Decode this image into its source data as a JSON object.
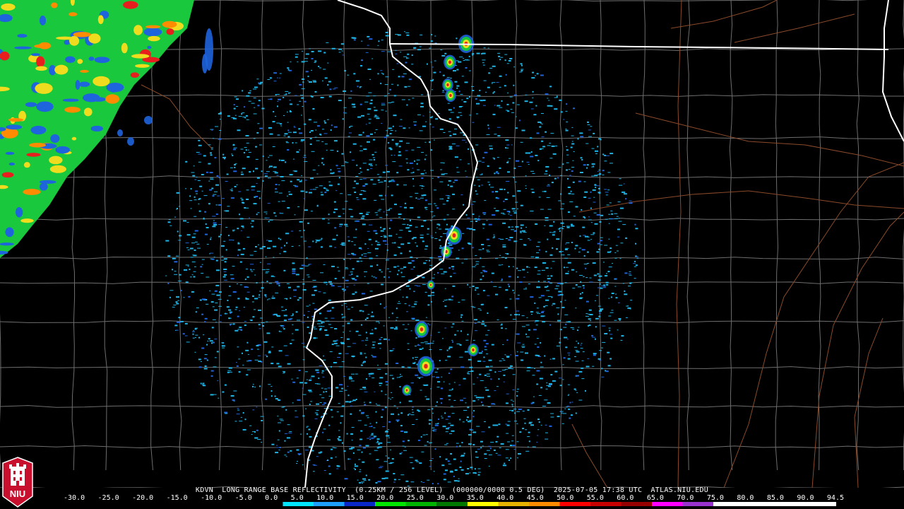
{
  "caption": {
    "station": "KDVN",
    "product": "LONG RANGE BASE REFLECTIVITY",
    "resolution": "(0.25KM / 256 LEVEL)",
    "volume": "(000000/0000 0.5 DEG)",
    "timestamp": "2025-07-05 17:38 UTC",
    "source": "ATLAS.NIU.EDU"
  },
  "legend": {
    "ticks": [
      "-30.0",
      "-25.0",
      "-20.0",
      "-15.0",
      "-10.0",
      "-5.0",
      "0.0",
      "5.0",
      "10.0",
      "15.0",
      "20.0",
      "25.0",
      "30.0",
      "35.0",
      "40.0",
      "45.0",
      "50.0",
      "55.0",
      "60.0",
      "65.0",
      "70.0",
      "75.0",
      "80.0",
      "85.0",
      "90.0",
      "94.5"
    ],
    "colors": [
      "#000000",
      "#000000",
      "#000000",
      "#000000",
      "#000000",
      "#000000",
      "#000000",
      "#00e5ff",
      "#1ea0ff",
      "#0a28c8",
      "#00e600",
      "#00b400",
      "#007800",
      "#ffff00",
      "#e6b400",
      "#ff8c00",
      "#ff0000",
      "#c80000",
      "#960000",
      "#ff00ff",
      "#9a32cd",
      "#ffffff",
      "#ffffff",
      "#ffffff",
      "#ffffff"
    ]
  },
  "logo": {
    "text": "NIU",
    "color": "#c8102e"
  },
  "map_colors": {
    "background": "#000000",
    "county_lines": "#707070",
    "highways": "#8b4a2a",
    "state_lines": "#ffffff",
    "echo_light": "#1fb4e6",
    "echo_blue": "#1e64dc",
    "echo_green": "#19c83c",
    "echo_yellow": "#f0dc1e",
    "echo_red": "#e61e1e"
  }
}
